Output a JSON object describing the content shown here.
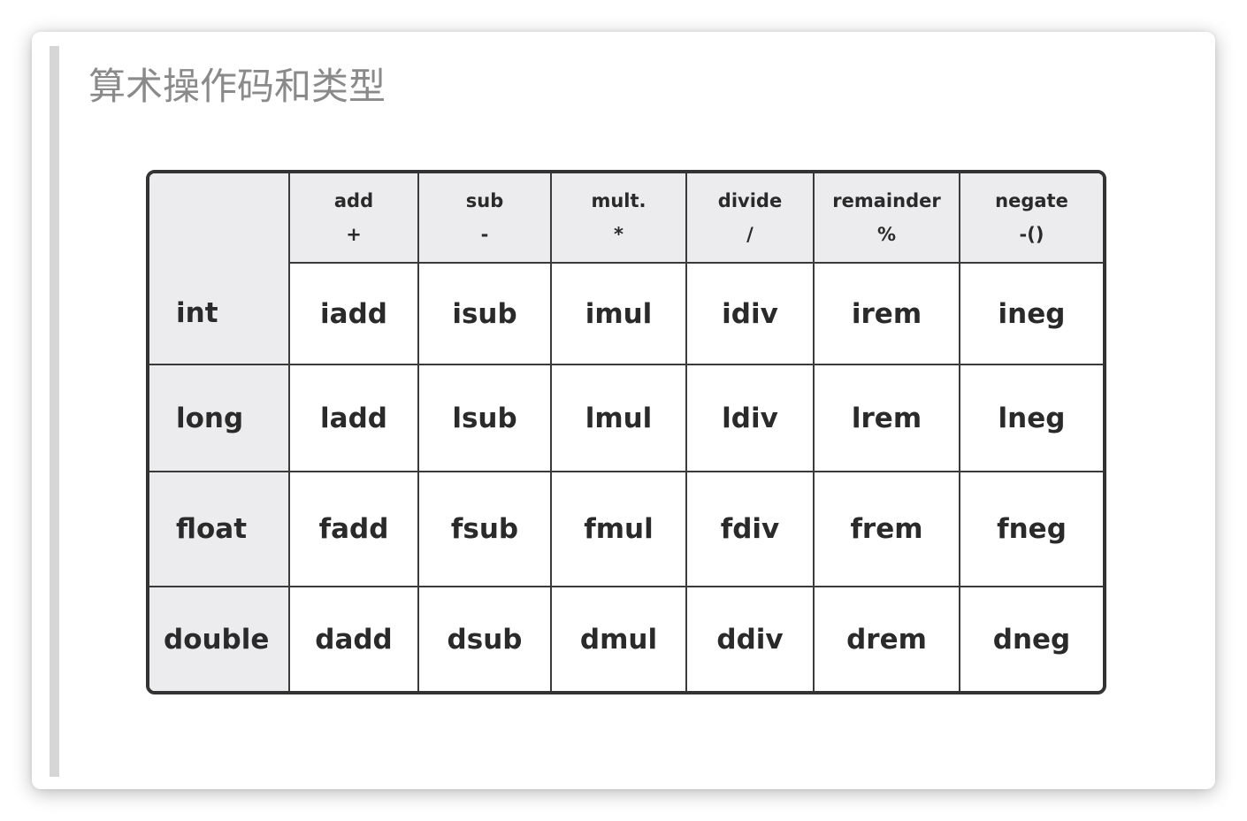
{
  "title": "算术操作码和类型",
  "table": {
    "columns": [
      {
        "name": "add",
        "symbol": "+"
      },
      {
        "name": "sub",
        "symbol": "-"
      },
      {
        "name": "mult.",
        "symbol": "*"
      },
      {
        "name": "divide",
        "symbol": "/"
      },
      {
        "name": "remainder",
        "symbol": "%"
      },
      {
        "name": "negate",
        "symbol": "-()"
      }
    ],
    "rows": [
      {
        "type": "int",
        "ops": [
          "iadd",
          "isub",
          "imul",
          "idiv",
          "irem",
          "ineg"
        ]
      },
      {
        "type": "long",
        "ops": [
          "ladd",
          "lsub",
          "lmul",
          "ldiv",
          "lrem",
          "lneg"
        ]
      },
      {
        "type": "float",
        "ops": [
          "fadd",
          "fsub",
          "fmul",
          "fdiv",
          "frem",
          "fneg"
        ]
      },
      {
        "type": "double",
        "ops": [
          "dadd",
          "dsub",
          "dmul",
          "ddiv",
          "drem",
          "dneg"
        ]
      }
    ]
  }
}
